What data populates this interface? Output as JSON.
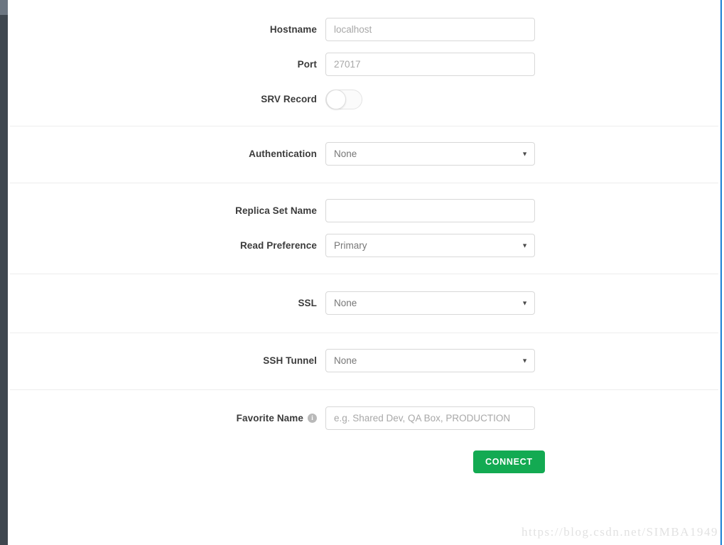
{
  "window": {
    "sidebar_color": "#3f474f",
    "sidebar_top_color": "#6c7681",
    "right_edge_color": "#1a7fd4"
  },
  "form": {
    "sections": [
      {
        "name": "host",
        "rows": [
          {
            "kind": "input",
            "label": "Hostname",
            "name": "hostname",
            "value": "",
            "placeholder": "localhost"
          },
          {
            "kind": "input",
            "label": "Port",
            "name": "port",
            "value": "",
            "placeholder": "27017"
          },
          {
            "kind": "toggle",
            "label": "SRV Record",
            "name": "srv-record",
            "state": "off"
          }
        ]
      },
      {
        "name": "authentication",
        "rows": [
          {
            "kind": "select",
            "label": "Authentication",
            "name": "authentication",
            "value": "None",
            "caret": "▼"
          }
        ]
      },
      {
        "name": "replica-set",
        "rows": [
          {
            "kind": "input",
            "label": "Replica Set Name",
            "name": "replica-set-name",
            "value": "",
            "placeholder": ""
          },
          {
            "kind": "select",
            "label": "Read Preference",
            "name": "read-preference",
            "value": "Primary",
            "caret": "▼"
          }
        ]
      },
      {
        "name": "ssl",
        "rows": [
          {
            "kind": "select",
            "label": "SSL",
            "name": "ssl",
            "value": "None",
            "caret": "▼"
          }
        ]
      },
      {
        "name": "ssh-tunnel",
        "rows": [
          {
            "kind": "select",
            "label": "SSH Tunnel",
            "name": "ssh-tunnel",
            "value": "None",
            "caret": "▼"
          }
        ]
      },
      {
        "name": "favorite",
        "rows": [
          {
            "kind": "input",
            "label": "Favorite Name",
            "name": "favorite-name",
            "value": "",
            "placeholder": "e.g. Shared Dev, QA Box, PRODUCTION",
            "info_icon": "i"
          }
        ]
      }
    ],
    "connect_button": {
      "label": "CONNECT",
      "color": "#13aa52"
    }
  },
  "watermark": {
    "text": "https://blog.csdn.net/SIMBA1949"
  }
}
